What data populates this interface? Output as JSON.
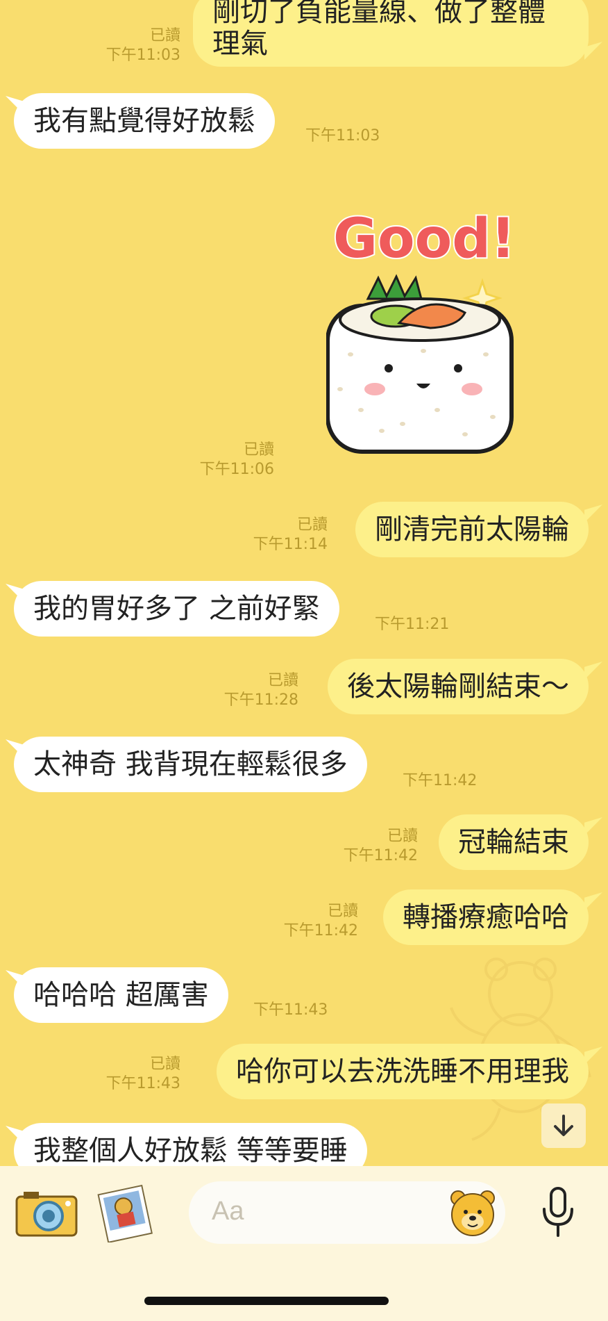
{
  "messages": [
    {
      "side": "out",
      "lines": [
        "剛切了負能量線、做了整體",
        "理氣"
      ],
      "read": "已讀",
      "time": "下午11:03"
    },
    {
      "side": "in",
      "text": "我有點覺得好放鬆",
      "time": "下午11:03"
    },
    {
      "side": "out",
      "sticker": {
        "text": "Good!",
        "icon": "sushi-roll-sticker"
      },
      "read": "已讀",
      "time": "下午11:06"
    },
    {
      "side": "out",
      "text": "剛清完前太陽輪",
      "read": "已讀",
      "time": "下午11:14"
    },
    {
      "side": "in",
      "text": "我的胃好多了 之前好緊",
      "time": "下午11:21"
    },
    {
      "side": "out",
      "text": "後太陽輪剛結束～",
      "read": "已讀",
      "time": "下午11:28"
    },
    {
      "side": "in",
      "text": "太神奇 我背現在輕鬆很多",
      "time": "下午11:42"
    },
    {
      "side": "out",
      "text": "冠輪結束",
      "read": "已讀",
      "time": "下午11:42"
    },
    {
      "side": "out",
      "text": "轉播療癒哈哈",
      "read": "已讀",
      "time": "下午11:42"
    },
    {
      "side": "in",
      "text": "哈哈哈 超厲害",
      "time": "下午11:43"
    },
    {
      "side": "out",
      "text": "哈你可以去洗洗睡不用理我",
      "read": "已讀",
      "time": "下午11:43"
    },
    {
      "side": "in",
      "text": "我整個人好放鬆 等等要睡",
      "time": ""
    }
  ],
  "input": {
    "placeholder": "Aa"
  },
  "icons": {
    "camera": "camera-icon",
    "gallery": "photo-gallery-icon",
    "emoji": "pooh-emoji-icon",
    "mic": "microphone-icon",
    "scroll": "arrow-down-icon"
  },
  "colors": {
    "background": "#f9dd6e",
    "outgoing": "#fdf08a",
    "incoming": "#ffffff",
    "meta": "#b89a2e"
  }
}
